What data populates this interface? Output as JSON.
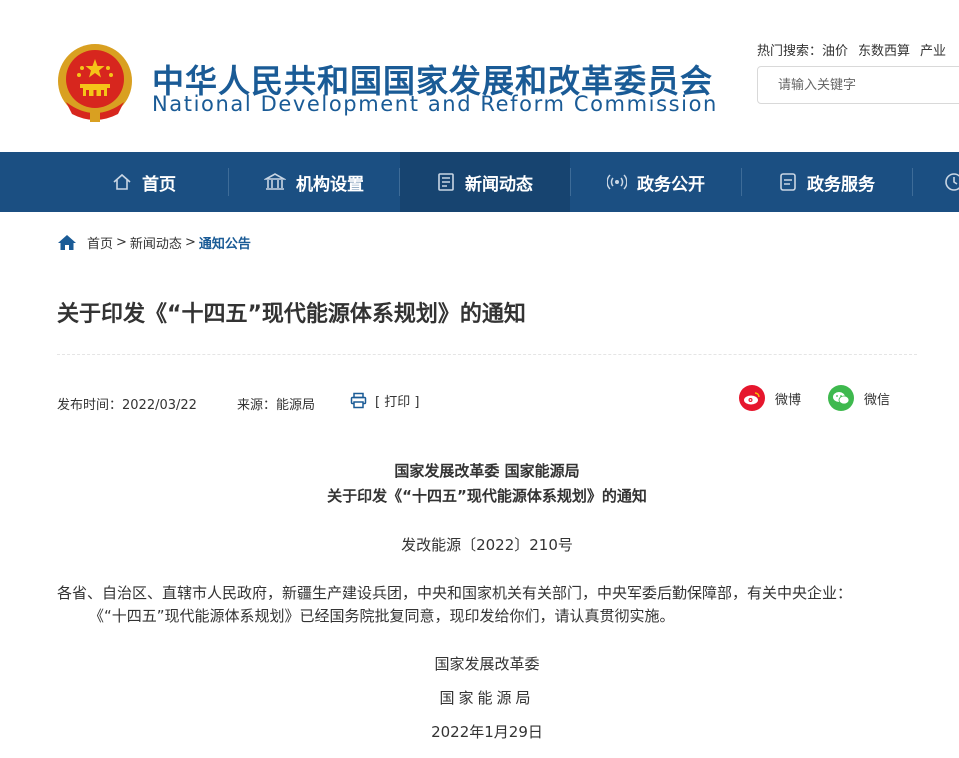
{
  "header": {
    "org_name_cn": "中华人民共和国国家发展和改革委员会",
    "org_name_en": "National Development and Reform Commission",
    "hot_search_label": "热门搜索：",
    "hot_keywords": [
      "油价",
      "东数西算",
      "产业"
    ],
    "search_placeholder": "请输入关键字"
  },
  "nav": {
    "items": [
      {
        "label": "首页",
        "icon": "home-icon"
      },
      {
        "label": "机构设置",
        "icon": "institution-icon"
      },
      {
        "label": "新闻动态",
        "icon": "news-icon",
        "active": true
      },
      {
        "label": "政务公开",
        "icon": "broadcast-icon"
      },
      {
        "label": "政务服务",
        "icon": "service-icon"
      }
    ]
  },
  "breadcrumb": {
    "items": [
      "首页",
      "新闻动态",
      "通知公告"
    ],
    "separator": ">"
  },
  "article": {
    "title": "关于印发《“十四五”现代能源体系规划》的通知",
    "publish_time": "发布时间：2022/03/22",
    "source": "来源：能源局",
    "print_label": "[ 打印 ]",
    "share": [
      {
        "label": "微博",
        "icon": "weibo-icon",
        "color": "#e6162d"
      },
      {
        "label": "微信",
        "icon": "wechat-icon",
        "color": "#3eb94e"
      }
    ],
    "body": {
      "issuer_line": "国家发展改革委 国家能源局",
      "heading_line": "关于印发《“十四五”现代能源体系规划》的通知",
      "doc_number": "发改能源〔2022〕210号",
      "recipients": "各省、自治区、直辖市人民政府，新疆生产建设兵团，中央和国家机关有关部门，中央军委后勤保障部，有关中央企业：",
      "paragraph": "《“十四五”现代能源体系规划》已经国务院批复同意，现印发给你们，请认真贯彻实施。",
      "signature_1": "国家发展改革委",
      "signature_2": "国家能源局",
      "date": "2022年1月29日"
    }
  },
  "colors": {
    "brand_blue": "#1a5b96",
    "nav_bg": "#1b4f82",
    "nav_active_bg": "#174470"
  }
}
